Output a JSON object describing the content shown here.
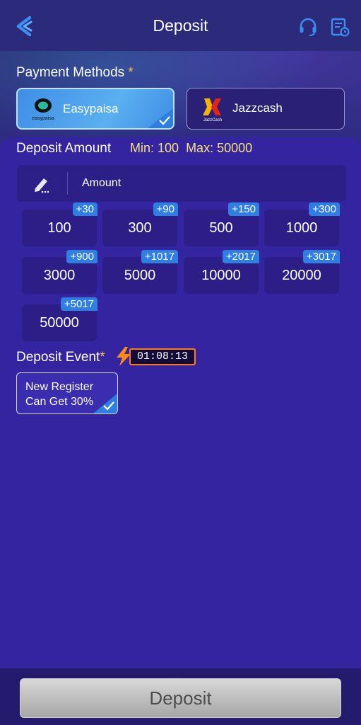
{
  "header": {
    "title": "Deposit"
  },
  "payment_methods": {
    "label": "Payment Methods",
    "required_mark": "*",
    "options": [
      {
        "name": "Easypaisa",
        "logo_text": "easypaisa",
        "selected": true
      },
      {
        "name": "Jazzcash",
        "logo_text": "JazzCash",
        "selected": false
      }
    ]
  },
  "deposit_amount": {
    "label": "Deposit Amount",
    "min_text": "Min: 100",
    "max_text": "Max: 50000",
    "input_placeholder": "Amount",
    "chips": [
      {
        "amount": "100",
        "bonus": "+30"
      },
      {
        "amount": "300",
        "bonus": "+90"
      },
      {
        "amount": "500",
        "bonus": "+150"
      },
      {
        "amount": "1000",
        "bonus": "+300"
      },
      {
        "amount": "3000",
        "bonus": "+900"
      },
      {
        "amount": "5000",
        "bonus": "+1017"
      },
      {
        "amount": "10000",
        "bonus": "+2017"
      },
      {
        "amount": "20000",
        "bonus": "+3017"
      },
      {
        "amount": "50000",
        "bonus": "+5017"
      }
    ]
  },
  "deposit_event": {
    "label": "Deposit Event",
    "required_mark": "*",
    "timer": "01:08:13",
    "option": {
      "line1": "New Register",
      "line2": "Can Get 30%",
      "selected": true
    }
  },
  "footer": {
    "deposit_label": "Deposit"
  },
  "colors": {
    "background": "#2b1f86",
    "panel": "#3524a0",
    "chip": "#2c1e86",
    "bonus_badge": "#2f7fe0",
    "selected_method": "#4a9de8",
    "accent_yellow": "#f2e27a",
    "timer_border": "#ff7a1a"
  }
}
